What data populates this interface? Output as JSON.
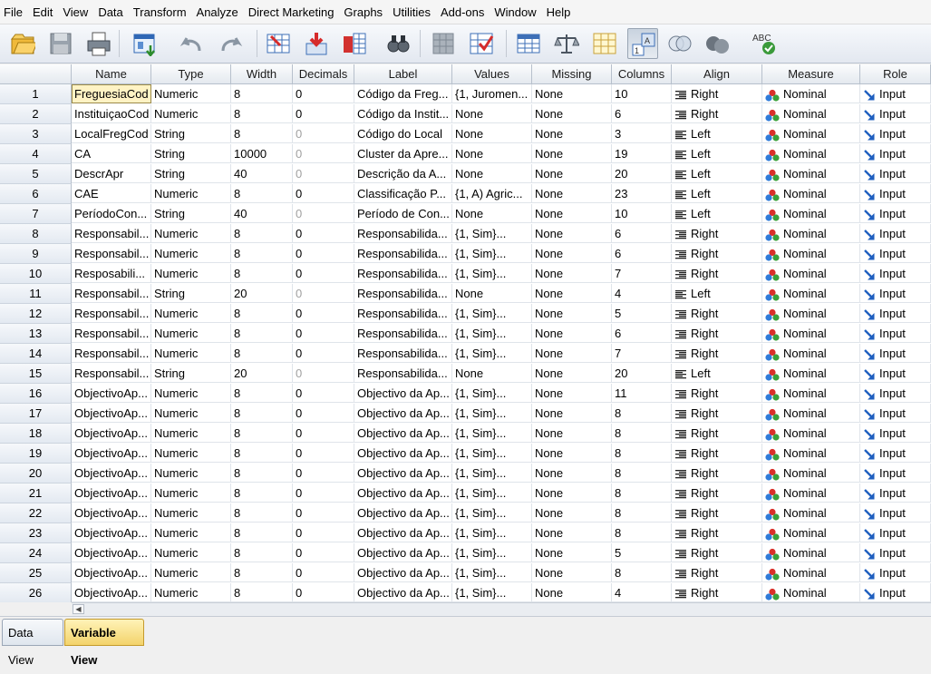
{
  "menu": [
    {
      "label": "File",
      "key": "File"
    },
    {
      "label": "Edit",
      "key": "Edit"
    },
    {
      "label": "View",
      "key": "View"
    },
    {
      "label": "Data",
      "key": "Data"
    },
    {
      "label": "Transform",
      "key": "Transform"
    },
    {
      "label": "Analyze",
      "key": "Analyze"
    },
    {
      "label": "Direct Marketing",
      "key": "DirectMarketing"
    },
    {
      "label": "Graphs",
      "key": "Graphs"
    },
    {
      "label": "Utilities",
      "key": "Utilities"
    },
    {
      "label": "Add-ons",
      "key": "Addons"
    },
    {
      "label": "Window",
      "key": "Window"
    },
    {
      "label": "Help",
      "key": "Help"
    }
  ],
  "toolbar_icons": [
    "open-icon",
    "save-icon",
    "print-icon",
    "recall-dialog-icon",
    "undo-icon",
    "redo-icon",
    "goto-case-icon",
    "goto-variable-icon",
    "variables-icon",
    "find-icon",
    "insert-cases-icon",
    "insert-variable-icon",
    "split-file-icon",
    "weight-cases-icon",
    "select-cases-icon",
    "value-labels-icon",
    "use-sets-icon",
    "show-all-variables-icon",
    "spell-check-icon"
  ],
  "columns": [
    "Name",
    "Type",
    "Width",
    "Decimals",
    "Label",
    "Values",
    "Missing",
    "Columns",
    "Align",
    "Measure",
    "Role"
  ],
  "rows": [
    {
      "n": "1",
      "name": "FreguesiaCod",
      "type": "Numeric",
      "width": "8",
      "decimals": "0",
      "label": "Código da Freg...",
      "values": "{1, Juromen...",
      "missing": "None",
      "columns": "10",
      "align": "Right",
      "measure": "Nominal",
      "role": "Input"
    },
    {
      "n": "2",
      "name": "InstituiçaoCod",
      "type": "Numeric",
      "width": "8",
      "decimals": "0",
      "label": "Código da Instit...",
      "values": "None",
      "missing": "None",
      "columns": "6",
      "align": "Right",
      "measure": "Nominal",
      "role": "Input"
    },
    {
      "n": "3",
      "name": "LocalFregCod",
      "type": "String",
      "width": "8",
      "decimals": "0",
      "label": "Código do Local",
      "values": "None",
      "missing": "None",
      "columns": "3",
      "align": "Left",
      "measure": "Nominal",
      "role": "Input"
    },
    {
      "n": "4",
      "name": "CA",
      "type": "String",
      "width": "10000",
      "decimals": "0",
      "label": "Cluster da Apre...",
      "values": "None",
      "missing": "None",
      "columns": "19",
      "align": "Left",
      "measure": "Nominal",
      "role": "Input"
    },
    {
      "n": "5",
      "name": "DescrApr",
      "type": "String",
      "width": "40",
      "decimals": "0",
      "label": "Descrição da A...",
      "values": "None",
      "missing": "None",
      "columns": "20",
      "align": "Left",
      "measure": "Nominal",
      "role": "Input"
    },
    {
      "n": "6",
      "name": "CAE",
      "type": "Numeric",
      "width": "8",
      "decimals": "0",
      "label": "Classificação P...",
      "values": "{1, A) Agric...",
      "missing": "None",
      "columns": "23",
      "align": "Left",
      "measure": "Nominal",
      "role": "Input"
    },
    {
      "n": "7",
      "name": "PeríodoCon...",
      "type": "String",
      "width": "40",
      "decimals": "0",
      "label": "Período de Con...",
      "values": "None",
      "missing": "None",
      "columns": "10",
      "align": "Left",
      "measure": "Nominal",
      "role": "Input"
    },
    {
      "n": "8",
      "name": "Responsabil...",
      "type": "Numeric",
      "width": "8",
      "decimals": "0",
      "label": "Responsabilida...",
      "values": "{1, Sim}...",
      "missing": "None",
      "columns": "6",
      "align": "Right",
      "measure": "Nominal",
      "role": "Input"
    },
    {
      "n": "9",
      "name": "Responsabil...",
      "type": "Numeric",
      "width": "8",
      "decimals": "0",
      "label": "Responsabilida...",
      "values": "{1, Sim}...",
      "missing": "None",
      "columns": "6",
      "align": "Right",
      "measure": "Nominal",
      "role": "Input"
    },
    {
      "n": "10",
      "name": "Resposabili...",
      "type": "Numeric",
      "width": "8",
      "decimals": "0",
      "label": "Responsabilida...",
      "values": "{1, Sim}...",
      "missing": "None",
      "columns": "7",
      "align": "Right",
      "measure": "Nominal",
      "role": "Input"
    },
    {
      "n": "11",
      "name": "Responsabil...",
      "type": "String",
      "width": "20",
      "decimals": "0",
      "label": "Responsabilida...",
      "values": "None",
      "missing": "None",
      "columns": "4",
      "align": "Left",
      "measure": "Nominal",
      "role": "Input"
    },
    {
      "n": "12",
      "name": "Responsabil...",
      "type": "Numeric",
      "width": "8",
      "decimals": "0",
      "label": "Responsabilida...",
      "values": "{1, Sim}...",
      "missing": "None",
      "columns": "5",
      "align": "Right",
      "measure": "Nominal",
      "role": "Input"
    },
    {
      "n": "13",
      "name": "Responsabil...",
      "type": "Numeric",
      "width": "8",
      "decimals": "0",
      "label": "Responsabilida...",
      "values": "{1, Sim}...",
      "missing": "None",
      "columns": "6",
      "align": "Right",
      "measure": "Nominal",
      "role": "Input"
    },
    {
      "n": "14",
      "name": "Responsabil...",
      "type": "Numeric",
      "width": "8",
      "decimals": "0",
      "label": "Responsabilida...",
      "values": "{1, Sim}...",
      "missing": "None",
      "columns": "7",
      "align": "Right",
      "measure": "Nominal",
      "role": "Input"
    },
    {
      "n": "15",
      "name": "Responsabil...",
      "type": "String",
      "width": "20",
      "decimals": "0",
      "label": "Responsabilida...",
      "values": "None",
      "missing": "None",
      "columns": "20",
      "align": "Left",
      "measure": "Nominal",
      "role": "Input"
    },
    {
      "n": "16",
      "name": "ObjectivoAp...",
      "type": "Numeric",
      "width": "8",
      "decimals": "0",
      "label": "Objectivo da Ap...",
      "values": "{1, Sim}...",
      "missing": "None",
      "columns": "11",
      "align": "Right",
      "measure": "Nominal",
      "role": "Input"
    },
    {
      "n": "17",
      "name": "ObjectivoAp...",
      "type": "Numeric",
      "width": "8",
      "decimals": "0",
      "label": "Objectivo da Ap...",
      "values": "{1, Sim}...",
      "missing": "None",
      "columns": "8",
      "align": "Right",
      "measure": "Nominal",
      "role": "Input"
    },
    {
      "n": "18",
      "name": "ObjectivoAp...",
      "type": "Numeric",
      "width": "8",
      "decimals": "0",
      "label": "Objectivo da Ap...",
      "values": "{1, Sim}...",
      "missing": "None",
      "columns": "8",
      "align": "Right",
      "measure": "Nominal",
      "role": "Input"
    },
    {
      "n": "19",
      "name": "ObjectivoAp...",
      "type": "Numeric",
      "width": "8",
      "decimals": "0",
      "label": "Objectivo da Ap...",
      "values": "{1, Sim}...",
      "missing": "None",
      "columns": "8",
      "align": "Right",
      "measure": "Nominal",
      "role": "Input"
    },
    {
      "n": "20",
      "name": "ObjectivoAp...",
      "type": "Numeric",
      "width": "8",
      "decimals": "0",
      "label": "Objectivo da Ap...",
      "values": "{1, Sim}...",
      "missing": "None",
      "columns": "8",
      "align": "Right",
      "measure": "Nominal",
      "role": "Input"
    },
    {
      "n": "21",
      "name": "ObjectivoAp...",
      "type": "Numeric",
      "width": "8",
      "decimals": "0",
      "label": "Objectivo da Ap...",
      "values": "{1, Sim}...",
      "missing": "None",
      "columns": "8",
      "align": "Right",
      "measure": "Nominal",
      "role": "Input"
    },
    {
      "n": "22",
      "name": "ObjectivoAp...",
      "type": "Numeric",
      "width": "8",
      "decimals": "0",
      "label": "Objectivo da Ap...",
      "values": "{1, Sim}...",
      "missing": "None",
      "columns": "8",
      "align": "Right",
      "measure": "Nominal",
      "role": "Input"
    },
    {
      "n": "23",
      "name": "ObjectivoAp...",
      "type": "Numeric",
      "width": "8",
      "decimals": "0",
      "label": "Objectivo da Ap...",
      "values": "{1, Sim}...",
      "missing": "None",
      "columns": "8",
      "align": "Right",
      "measure": "Nominal",
      "role": "Input"
    },
    {
      "n": "24",
      "name": "ObjectivoAp...",
      "type": "Numeric",
      "width": "8",
      "decimals": "0",
      "label": "Objectivo da Ap...",
      "values": "{1, Sim}...",
      "missing": "None",
      "columns": "5",
      "align": "Right",
      "measure": "Nominal",
      "role": "Input"
    },
    {
      "n": "25",
      "name": "ObjectivoAp...",
      "type": "Numeric",
      "width": "8",
      "decimals": "0",
      "label": "Objectivo da Ap...",
      "values": "{1, Sim}...",
      "missing": "None",
      "columns": "8",
      "align": "Right",
      "measure": "Nominal",
      "role": "Input"
    },
    {
      "n": "26",
      "name": "ObjectivoAp...",
      "type": "Numeric",
      "width": "8",
      "decimals": "0",
      "label": "Objectivo da Ap...",
      "values": "{1, Sim}...",
      "missing": "None",
      "columns": "4",
      "align": "Right",
      "measure": "Nominal",
      "role": "Input"
    }
  ],
  "tabs": {
    "data_view": "Data View",
    "variable_view": "Variable View"
  },
  "colors": {
    "selected_tab": "#f3d36b",
    "selected_cell": "#fff3c4",
    "header_bg": "#e4e9ef",
    "role_arrow": "#1f5fbf"
  }
}
